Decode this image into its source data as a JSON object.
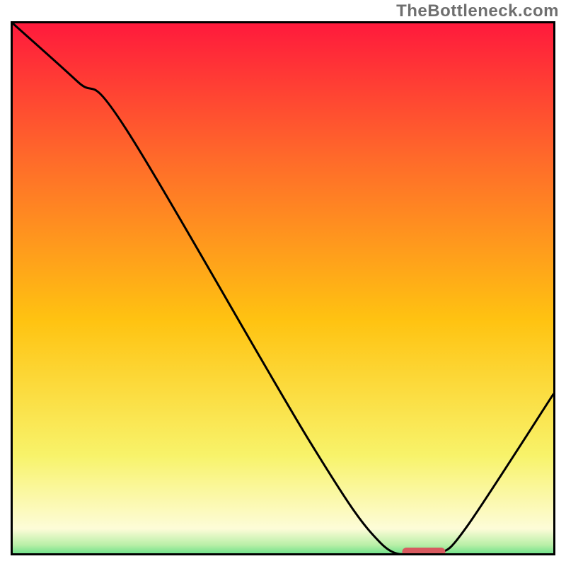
{
  "watermark": "TheBottleneck.com",
  "chart_data": {
    "type": "line",
    "title": "",
    "xlabel": "",
    "ylabel": "",
    "xlim": [
      0,
      100
    ],
    "ylim": [
      0,
      100
    ],
    "background": {
      "type": "linear-gradient",
      "stops": [
        {
          "offset": 0.0,
          "color": "#ff1a3c"
        },
        {
          "offset": 0.25,
          "color": "#ff6a2a"
        },
        {
          "offset": 0.55,
          "color": "#ffc311"
        },
        {
          "offset": 0.8,
          "color": "#f8f36a"
        },
        {
          "offset": 0.935,
          "color": "#fdfcd8"
        },
        {
          "offset": 0.965,
          "color": "#b9efa7"
        },
        {
          "offset": 1.0,
          "color": "#1ed36a"
        }
      ]
    },
    "series": [
      {
        "name": "bottleneck-curve",
        "x": [
          0,
          12,
          21,
          55,
          68,
          75,
          79,
          84,
          100
        ],
        "y": [
          100,
          89,
          80,
          21,
          2,
          0,
          0,
          5,
          30
        ]
      }
    ],
    "marker": {
      "name": "optimal-range",
      "x_center": 76,
      "width_x": 8,
      "y": 0,
      "color": "#d85a5f"
    }
  }
}
